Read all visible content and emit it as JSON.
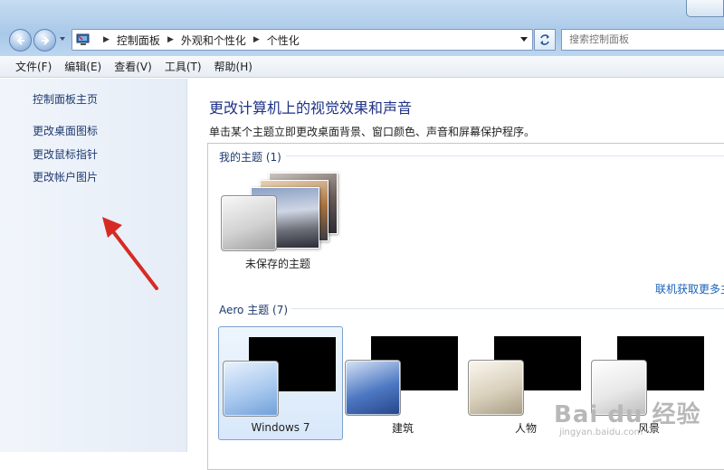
{
  "window": {
    "address_crumbs": [
      "控制面板",
      "外观和个性化",
      "个性化"
    ],
    "search_placeholder": "搜索控制面板"
  },
  "menu": [
    "文件(F)",
    "编辑(E)",
    "查看(V)",
    "工具(T)",
    "帮助(H)"
  ],
  "sidebar": {
    "links": [
      "控制面板主页",
      "更改桌面图标",
      "更改鼠标指针",
      "更改帐户图片"
    ]
  },
  "main": {
    "title": "更改计算机上的视觉效果和声音",
    "description": "单击某个主题立即更改桌面背景、窗口颜色、声音和屏幕保护程序。",
    "my_themes": {
      "header": "我的主题 (1)",
      "item_label": "未保存的主题",
      "get_more_link": "联机获取更多主"
    },
    "aero_themes": {
      "header": "Aero 主题 (7)",
      "items": [
        {
          "name": "Windows 7",
          "selected": true,
          "tile_color": "#a9c9ee"
        },
        {
          "name": "建筑",
          "selected": false,
          "tile_color": "#4d78c2"
        },
        {
          "name": "人物",
          "selected": false,
          "tile_color": "#d9d0bc"
        },
        {
          "name": "风景",
          "selected": false,
          "tile_color": "#e8e8e8"
        }
      ]
    }
  },
  "colors": {
    "link": "#1e3a6e",
    "title": "#1e3287",
    "annotation_arrow": "#d62b24"
  },
  "watermark": {
    "brand": "Bai du 经验",
    "url": "jingyan.baidu.com"
  }
}
